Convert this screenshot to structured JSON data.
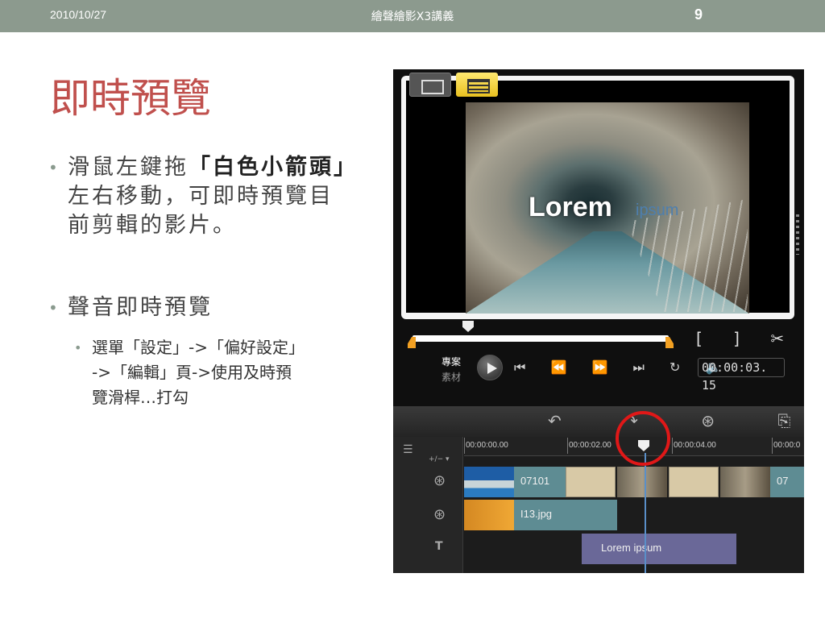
{
  "header": {
    "date": "2010/10/27",
    "title": "繪聲繪影X3講義",
    "page_number": "9"
  },
  "slide": {
    "title": "即時預覽",
    "bullet1_line1_pre": "滑鼠左鍵拖",
    "bullet1_line1_bold": "「白色小箭頭」",
    "bullet1_line2": "左右移動，可即時預覽目",
    "bullet1_line3": "前剪輯的影片。",
    "bullet2": "聲音即時預覽",
    "sub_line1": "選單「設定」->「偏好設定」",
    "sub_line2": "->「編輯」頁->使用及時預",
    "sub_line3": "覽滑桿…打勾",
    "bullet_symbol": "•"
  },
  "player": {
    "overlay_title": "Lorem",
    "overlay_subtitle": "ipsum",
    "label_project": "專案",
    "label_clip": "素材",
    "timecode": "00:00:03. 15",
    "edit_icons": "[ ] ✂ ⧉",
    "transport_icons": "⏮ ⏪ ⏩ ⏭ ↻ 🔈"
  },
  "timeline": {
    "toolbar_icons": "↶ ↷ ⊛ ⎘ ⎘",
    "ruler": [
      "00:00:00.00",
      "00:00:02.00",
      "00:00:04.00",
      "00:00:0"
    ],
    "video_clip_1": "07101",
    "video_clip_2": "07",
    "overlay_clip": "I13.jpg",
    "title_clip": "Lorem ipsum",
    "add_remove": "+/− ▾"
  },
  "colors": {
    "header_bar": "#8c9a8e",
    "title_red": "#c0504d",
    "highlight_circle": "#e01818",
    "timeline_active": "#f0d040"
  },
  "icons": [
    "storyboard-view-icon",
    "timeline-view-icon",
    "undo-icon",
    "redo-icon",
    "record-capture-icon",
    "mix-audio-icon",
    "play-icon",
    "trim-mark-in-icon",
    "trim-mark-out-icon",
    "split-clip-icon",
    "enlarge-preview-icon"
  ]
}
